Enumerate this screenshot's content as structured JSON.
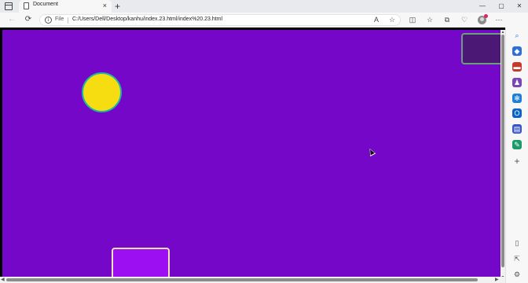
{
  "browser": {
    "tab_title": "Document",
    "tab_close": "×",
    "new_tab": "+",
    "window_controls": {
      "minimize": "—",
      "maximize": "▢",
      "close": "✕"
    },
    "address": {
      "scheme_label": "File",
      "url": "C:/Users/Dell/Desktop/kanhu/index.23.html/index%20.23.html"
    },
    "nav": {
      "back": "←",
      "refresh": "⟳"
    },
    "toolbar_icons": {
      "read_aloud": "A",
      "favorite_star": "☆",
      "split_screen": "◫",
      "favorites": "☆",
      "collections": "⧉",
      "browser_essentials": "♡",
      "more": "⋯"
    }
  },
  "sidebar": {
    "items": [
      {
        "name": "search",
        "glyph": "⌕",
        "color": "#2f6fd6"
      },
      {
        "name": "tag",
        "glyph": "◆",
        "color": "#2f6fd6"
      },
      {
        "name": "toolbox",
        "glyph": "▬",
        "color": "#c43b2a"
      },
      {
        "name": "games",
        "glyph": "♟",
        "color": "#7a45b5"
      },
      {
        "name": "copilot",
        "glyph": "✻",
        "color": "#1e7fd8"
      },
      {
        "name": "outlook",
        "glyph": "O",
        "color": "#0a64c8"
      },
      {
        "name": "office",
        "glyph": "▤",
        "color": "#3b55c0"
      },
      {
        "name": "designer",
        "glyph": "✎",
        "color": "#1d9a6c"
      },
      {
        "name": "add",
        "glyph": "+",
        "color": "#555555"
      }
    ],
    "bottom": {
      "sidebar_toggle": "▯",
      "open_external": "⇱",
      "settings": "⚙"
    }
  },
  "game": {
    "background_color": "#7407c8",
    "ball_color": "#f6dd11",
    "ball_border_color": "#1bb7a3",
    "paddle_color": "#9c0ff2",
    "score_box_color": "#4b1876"
  }
}
